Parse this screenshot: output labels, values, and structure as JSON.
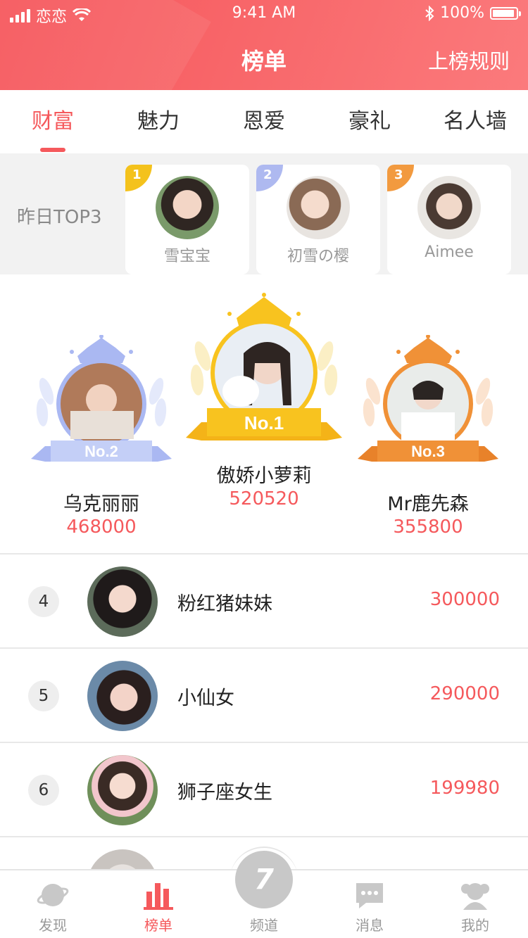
{
  "status_bar": {
    "carrier": "恋恋",
    "time": "9:41 AM",
    "battery": "100%"
  },
  "header": {
    "title": "榜单",
    "rules_label": "上榜规则"
  },
  "tabs": [
    {
      "label": "财富",
      "active": true
    },
    {
      "label": "魅力",
      "active": false
    },
    {
      "label": "恩爱",
      "active": false
    },
    {
      "label": "豪礼",
      "active": false
    },
    {
      "label": "名人墙",
      "active": false
    }
  ],
  "yesterday": {
    "label": "昨日TOP3",
    "items": [
      {
        "rank": "1",
        "name": "雪宝宝",
        "color": "#f4c21c"
      },
      {
        "rank": "2",
        "name": "初雪の樱",
        "color": "#aeb9f0"
      },
      {
        "rank": "3",
        "name": "Aimee",
        "color": "#f29a3f"
      }
    ]
  },
  "podium": {
    "first": {
      "badge": "No.1",
      "name": "傲娇小萝莉",
      "score": "520520",
      "color": "#f8c31f"
    },
    "second": {
      "badge": "No.2",
      "name": "乌克丽丽",
      "score": "468000",
      "color": "#aab8f2"
    },
    "third": {
      "badge": "No.3",
      "name": "Mr鹿先森",
      "score": "355800",
      "color": "#f09137"
    }
  },
  "ranking_list": [
    {
      "rank": "4",
      "name": "粉红猪妹妹",
      "score": "300000"
    },
    {
      "rank": "5",
      "name": "小仙女",
      "score": "290000"
    },
    {
      "rank": "6",
      "name": "狮子座女生",
      "score": "199980"
    }
  ],
  "bottom_nav": [
    {
      "label": "发现",
      "icon": "planet-icon",
      "active": false
    },
    {
      "label": "榜单",
      "icon": "bar-chart-icon",
      "active": true
    },
    {
      "label": "频道",
      "icon": "channel-icon",
      "active": false
    },
    {
      "label": "消息",
      "icon": "message-icon",
      "active": false
    },
    {
      "label": "我的",
      "icon": "profile-icon",
      "active": false
    }
  ],
  "colors": {
    "brand": "#f5595c",
    "header_gradient_start": "#f6555a",
    "header_gradient_end": "#fb7a7c"
  }
}
